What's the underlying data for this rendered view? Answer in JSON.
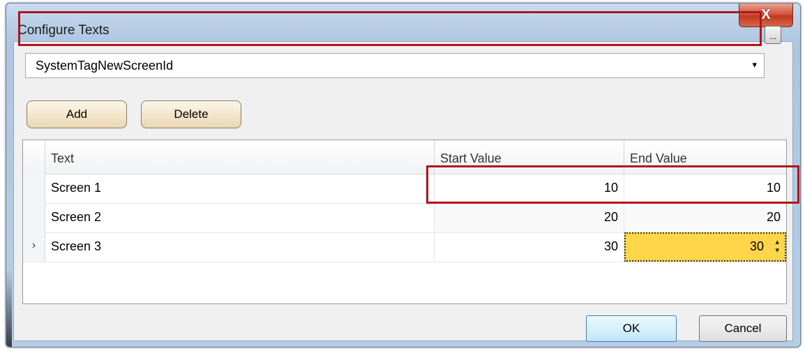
{
  "window": {
    "title": "Configure Texts",
    "close_label": "X"
  },
  "tag_selector": {
    "value": "SystemTagNewScreenId",
    "dropdown_arrow": "▾",
    "browse_label": "..."
  },
  "toolbar": {
    "add_label": "Add",
    "delete_label": "Delete"
  },
  "grid": {
    "columns": [
      "Text",
      "Start Value",
      "End Value"
    ],
    "rows": [
      {
        "indicator": "",
        "text": "Screen 1",
        "start": "10",
        "end": "10"
      },
      {
        "indicator": "",
        "text": "Screen 2",
        "start": "20",
        "end": "20"
      },
      {
        "indicator": "›",
        "text": "Screen 3",
        "start": "30",
        "end": "30"
      }
    ]
  },
  "footer": {
    "ok_label": "OK",
    "cancel_label": "Cancel"
  },
  "colors": {
    "highlight": "#b0151e",
    "editing_cell": "#ffd54a"
  }
}
